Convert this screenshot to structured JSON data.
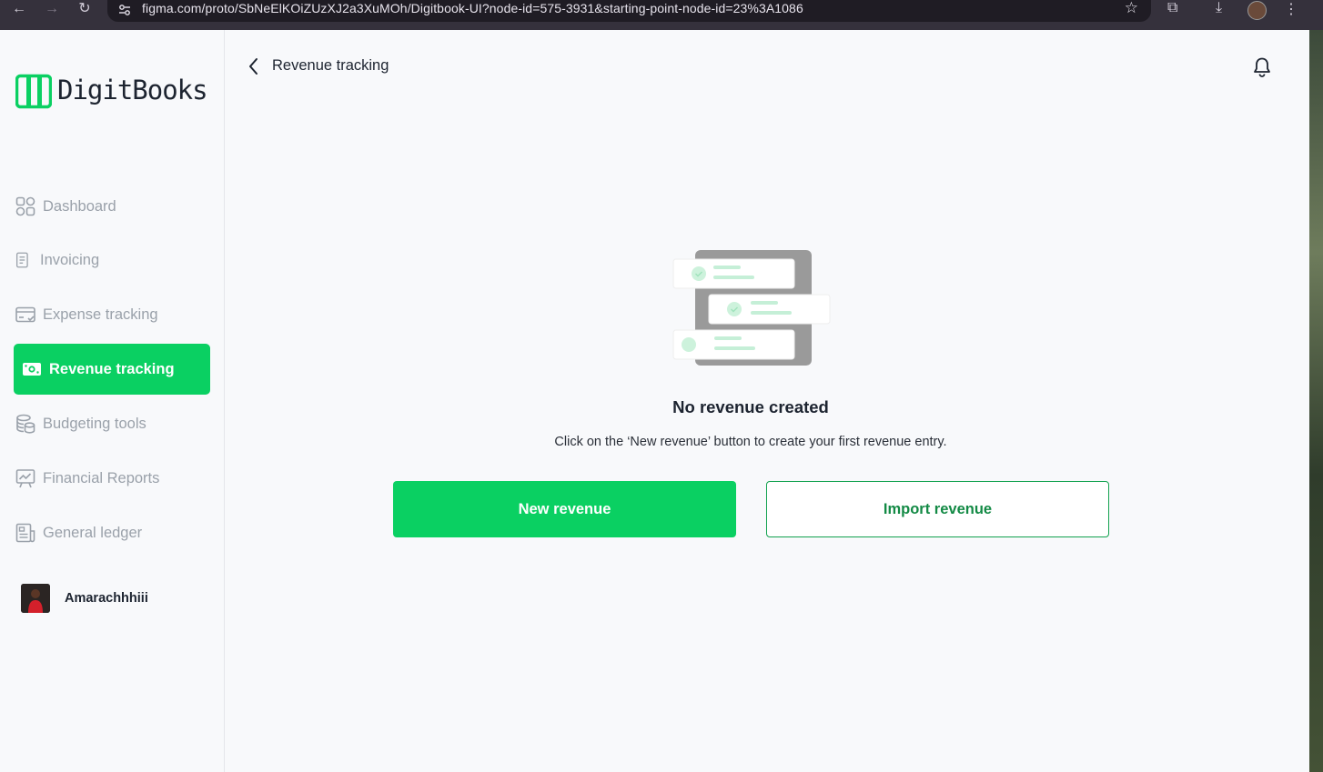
{
  "browser": {
    "url": "figma.com/proto/SbNeElKOiZUzXJ2a3XuMOh/Digitbook-UI?node-id=575-3931&starting-point-node-id=23%3A1086"
  },
  "brand": {
    "name": "DigitBooks",
    "accent": "#0ad062"
  },
  "sidebar": {
    "items": [
      {
        "label": "Dashboard",
        "icon": "dashboard-grid-icon"
      },
      {
        "label": "Invoicing",
        "icon": "invoice-doc-icon"
      },
      {
        "label": "Expense tracking",
        "icon": "credit-card-icon"
      },
      {
        "label": "Revenue tracking",
        "icon": "money-icon",
        "active": true
      },
      {
        "label": "Budgeting tools",
        "icon": "coins-stack-icon"
      },
      {
        "label": "Financial Reports",
        "icon": "chart-presentation-icon"
      },
      {
        "label": "General ledger",
        "icon": "ledger-doc-icon"
      }
    ],
    "user": {
      "name": "Amarachhhiii"
    }
  },
  "header": {
    "title": "Revenue tracking"
  },
  "empty_state": {
    "title": "No revenue created",
    "message": "Click on the ‘New revenue’ button to create your first revenue entry.",
    "primary_button": "New revenue",
    "secondary_button": "Import revenue"
  }
}
